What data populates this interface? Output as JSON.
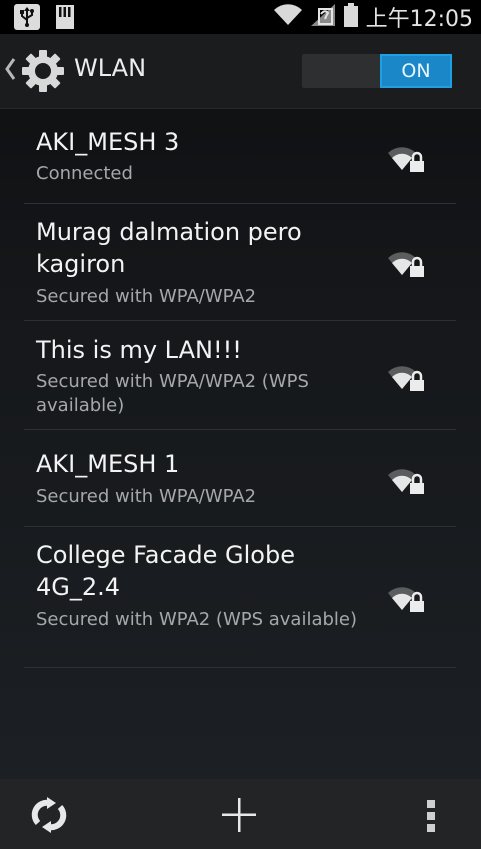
{
  "status_bar": {
    "time": "上午12:05",
    "icons": [
      "usb-icon",
      "sd-card-icon",
      "wifi-signal-icon",
      "no-signal-icon",
      "battery-icon"
    ]
  },
  "action_bar": {
    "title": "WLAN",
    "toggle_label": "ON"
  },
  "networks": [
    {
      "ssid": "AKI_MESH 3",
      "status": "Connected"
    },
    {
      "ssid": "Murag dalmation pero kagiron",
      "status": "Secured with WPA/WPA2"
    },
    {
      "ssid": "This is my LAN!!!",
      "status": "Secured with WPA/WPA2 (WPS available)"
    },
    {
      "ssid": "AKI_MESH 1",
      "status": "Secured with WPA/WPA2"
    },
    {
      "ssid": "College Facade Globe 4G_2.4",
      "status": "Secured with WPA2 (WPS available)"
    }
  ],
  "bottom_bar": {
    "icons": [
      "refresh-icon",
      "add-network-icon",
      "overflow-menu-icon"
    ]
  },
  "colors": {
    "accent": "#1a87c8",
    "text_primary": "#f3f3f3",
    "text_secondary": "#a6a7a8"
  }
}
